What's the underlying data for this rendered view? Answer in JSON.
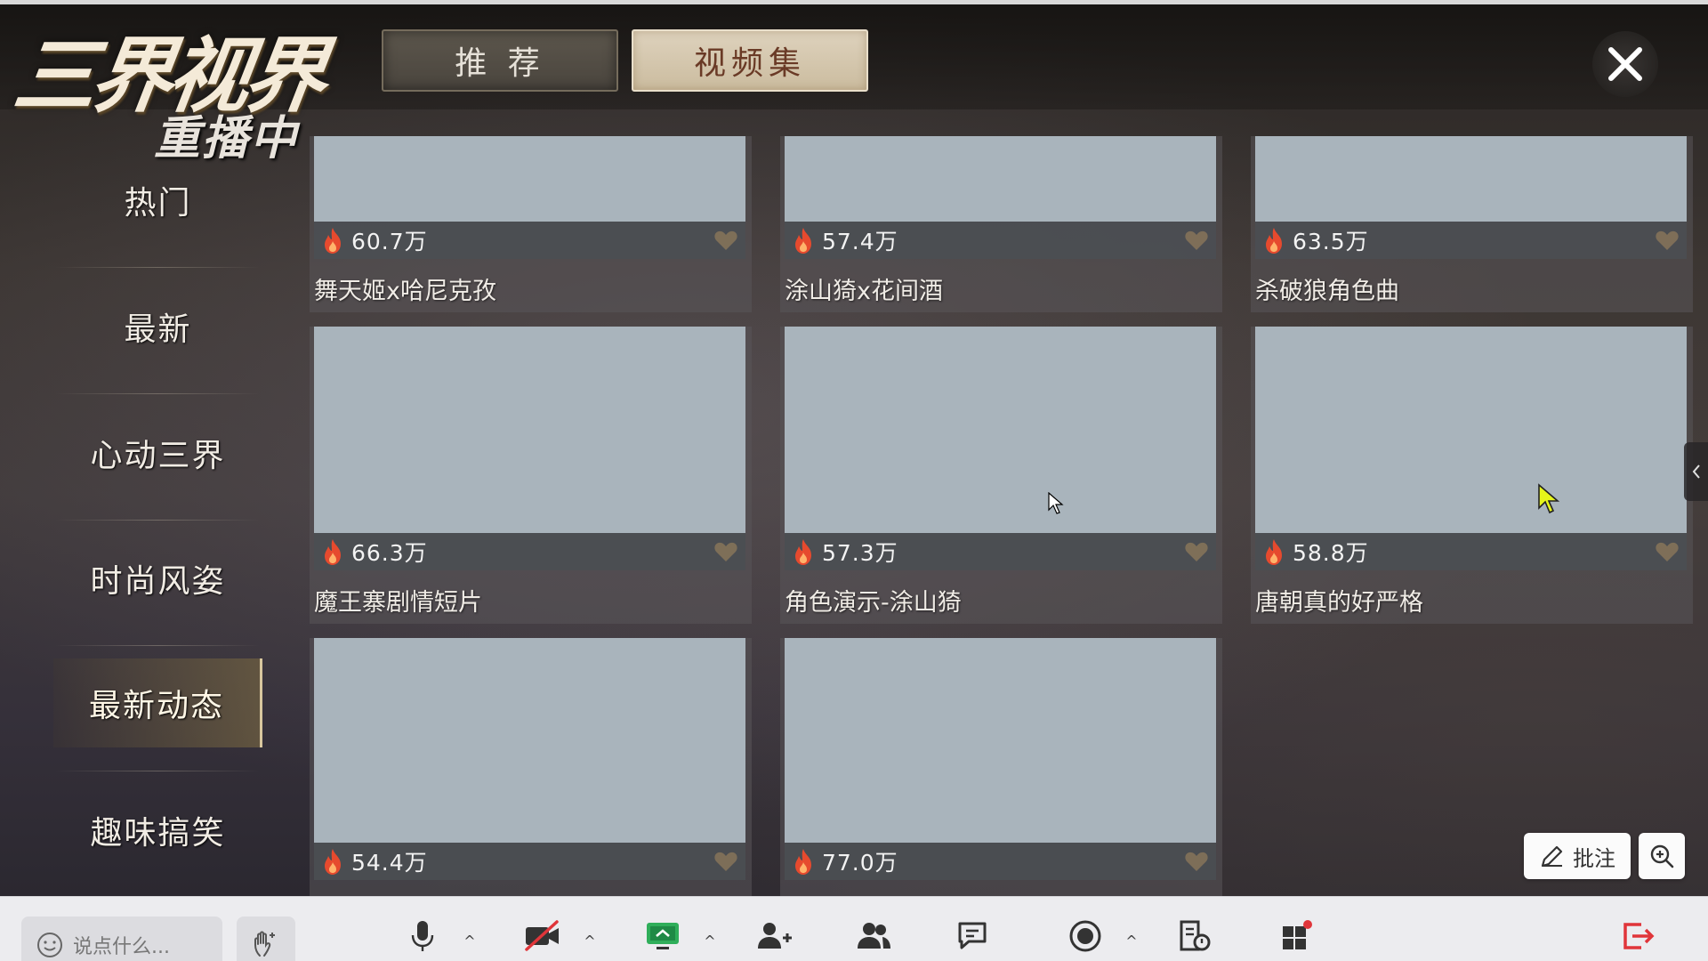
{
  "header": {
    "logo_title": "三界视界",
    "logo_status": "重播中",
    "tabs": [
      {
        "label": "推 荐",
        "active": false
      },
      {
        "label": "视频集",
        "active": true
      }
    ]
  },
  "nav": {
    "items": [
      {
        "label": "热门",
        "active": false
      },
      {
        "label": "最新",
        "active": false
      },
      {
        "label": "心动三界",
        "active": false
      },
      {
        "label": "时尚风姿",
        "active": false
      },
      {
        "label": "最新动态",
        "active": true
      },
      {
        "label": "趣味搞笑",
        "active": false
      }
    ]
  },
  "videos": [
    {
      "views": "60.7万",
      "title": "舞天姬x哈尼克孜"
    },
    {
      "views": "57.4万",
      "title": "涂山猗x花间酒"
    },
    {
      "views": "63.5万",
      "title": "杀破狼角色曲"
    },
    {
      "views": "66.3万",
      "title": "魔王寨剧情短片"
    },
    {
      "views": "57.3万",
      "title": "角色演示-涂山猗"
    },
    {
      "views": "58.8万",
      "title": "唐朝真的好严格"
    },
    {
      "views": "54.4万",
      "title": ""
    },
    {
      "views": "77.0万",
      "title": ""
    }
  ],
  "overlay": {
    "annotate_label": "批注"
  },
  "toolbar": {
    "chat_placeholder": "说点什么..."
  },
  "colors": {
    "accent_tab": "#cbbc9f",
    "thumb_placeholder": "#a9b4bc",
    "fire": "#e64a2e",
    "exit": "#e0353a"
  },
  "icons": [
    "close-icon",
    "fire-icon",
    "heart-icon",
    "pen-icon",
    "zoom-in-icon",
    "smile-icon",
    "hand-icon",
    "microphone-icon",
    "camera-off-icon",
    "screen-share-icon",
    "add-user-icon",
    "participants-icon",
    "chat-icon",
    "record-icon",
    "document-icon",
    "apps-icon",
    "exit-icon"
  ]
}
